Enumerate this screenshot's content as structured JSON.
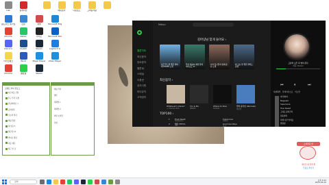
{
  "desktop": {
    "icons": [
      {
        "label": "Lisk",
        "color": "#8a8a8a"
      },
      {
        "label": "알게이션",
        "color": "#d02a2a"
      },
      {
        "label": "",
        "color": "#f3c94c"
      },
      {
        "label": "메뉴보다",
        "color": "#f3c94c"
      },
      {
        "label": "다운로드",
        "color": "#f3c94c"
      },
      {
        "label": "고마운사람",
        "color": "#f3c94c"
      },
      {
        "label": "",
        "color": "#f3c94c"
      },
      {
        "label": "원드우스 생기입",
        "color": "#2d7ad6"
      },
      {
        "label": "한글",
        "color": "#3a86d1"
      },
      {
        "label": "재생",
        "color": "#d04b4b"
      },
      {
        "label": "Microsoft Edge",
        "color": "#1e88d8"
      },
      {
        "label": "Chrome",
        "color": "#e34133"
      },
      {
        "label": "Kakao",
        "color": "#2ac56a"
      },
      {
        "label": "카카오",
        "color": "#222222"
      },
      {
        "label": "Microsoft Store",
        "color": "#0a62c7"
      },
      {
        "label": "Discord",
        "color": "#5865f2"
      },
      {
        "label": "Vivaldi",
        "color": "#1d4e8f"
      },
      {
        "label": "Steam",
        "color": "#1b2838"
      },
      {
        "label": "Logitech G",
        "color": "#1d7ee0"
      },
      {
        "label": "카카오뱅크",
        "color": "#f4d54c"
      },
      {
        "label": "Word",
        "color": "#2b5cb8"
      },
      {
        "label": "Magic Player",
        "color": "#1f8fe0"
      },
      {
        "label": "Video Player",
        "color": "#1f8fe0"
      },
      {
        "label": "Chrome",
        "color": "#e34133"
      },
      {
        "label": "멜론웹",
        "color": "#2bd04a"
      },
      {
        "label": "Steam",
        "color": "#1b2838"
      }
    ]
  },
  "music_app": {
    "brand": "Melon",
    "nav": [
      "멜론차트",
      "최신음악",
      "장르음악",
      "멜론DJ",
      "스페셜",
      "이용권",
      "공지사항",
      "마이뮤직",
      "고객센터"
    ],
    "recommend_title": "김아녕님 맞게 들어요 ›",
    "cards": [
      {
        "caption": "지금 들으면 좋은 엔비제 FAVRE 노래",
        "color": "#6fb3e6"
      },
      {
        "caption": "우리 마음속 평생 플레이리스트 #...",
        "color": "#3b7a6a"
      },
      {
        "caption": "나의 친구들과 함께 듣는 노래",
        "color": "#8c6a5c"
      },
      {
        "caption": "비 오는 날 좋은 발라드 감성",
        "color": "#4d6b8a"
      }
    ],
    "latest_title": "최신음악 ›",
    "albums": [
      {
        "title": "Whatever's Clever!",
        "artist": "+ Charlie Puth",
        "color": "#c7b7a3"
      },
      {
        "title": "You & Me",
        "artist": "JENNIE",
        "color": "#2b2b2b"
      },
      {
        "title": "Where to Now",
        "artist": "SHAUN",
        "color": "#0f0f0f"
      },
      {
        "title": "별의 중학생 (Remake)",
        "artist": "제미마",
        "color": "#4a7dbd"
      }
    ],
    "top_title": "TOP100 ›",
    "top_rows": [
      {
        "rank": "1",
        "title": "How Sweet",
        "artist": "NewJeans",
        "title2": "Supernova",
        "artist2": "aespa"
      },
      {
        "rank": "2",
        "title": "해야 (HEYA)",
        "artist": "IVE",
        "title2": "Good Goodbye",
        "artist2": "화사"
      }
    ]
  },
  "player": {
    "song": "고남의 오른 후 밤이 온다",
    "artist": "하운 (Rizzz)",
    "progress": 0.22,
    "tabs": "재생목록 · 플레이리스트 · 믹스업",
    "playlist": [
      {
        "title": "네 편이야",
        "artist": "임재현"
      },
      {
        "title": "Magnetic",
        "artist": "ILLIT"
      },
      {
        "title": "Supernova",
        "artist": "aespa"
      },
      {
        "title": "How Sweet",
        "artist": "NewJeans"
      },
      {
        "title": "그대로 흘러간다",
        "artist": "10CM"
      },
      {
        "title": "청춘만화",
        "artist": "이무진"
      },
      {
        "title": "이제 나만 믿어요",
        "artist": "임영웅"
      },
      {
        "title": "밤양갱",
        "artist": "비비 (BIBI)"
      }
    ]
  },
  "messenger": {
    "title": "코멘트 마이 블로그",
    "lines": [
      "서로이웃 신청",
      "친구 추가 요청",
      "안녕하세요 :)",
      "공지사항",
      "오늘의 일기",
      "채팅 알림",
      "새 댓글 3",
      "방문자 12",
      "좋아요 알림",
      "이웃 새글",
      "최근 본 글"
    ],
    "panel_title": "채팅 목록",
    "panel_lines": [
      "멜론",
      "대화방 1",
      "대화방 2",
      "파일 보관함",
      "설정"
    ]
  },
  "taskbar": {
    "search_placeholder": "검색",
    "time": "오후 4:44",
    "date": "2024-05-20"
  },
  "widget": {
    "tag": "조을원준 원",
    "caption1": "멜론을 꼭 들려 잘",
    "caption2": "무료로 즐기기"
  }
}
